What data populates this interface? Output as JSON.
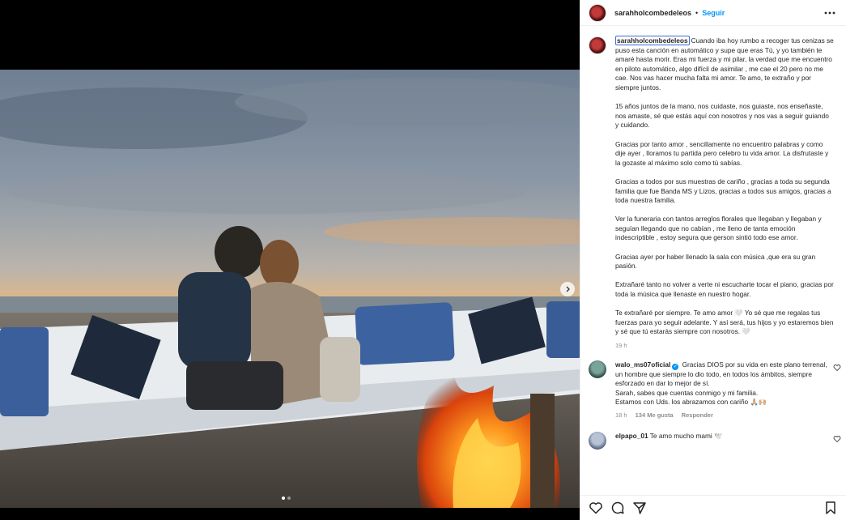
{
  "post": {
    "username": "sarahholcombedeleos",
    "follow_label": "Seguir",
    "separator": "•",
    "caption": [
      "Cuando iba hoy rumbo a recoger tus cenizas se puso esta canción en automático y supe que eras Tú, y yo también te amaré hasta morir. Eras mi fuerza y mi pilar, la verdad que me encuentro en piloto automático, algo difícil de asimilar , me cae el 20 pero no me cae. Nos vas hacer mucha falta mi amor. Te amo, te extraño y por siempre juntos.",
      "15 años juntos de la mano, nos cuidaste, nos guiaste, nos enseñaste, nos amaste, sé que estás aquí con nosotros y nos vas a seguir guiando y cuidando.",
      "Gracias por tanto amor , sencillamente no encuentro palabras y como dije ayer , lloramos tu partida pero celebro tu vida amor. La disfrutaste y la gozaste al máximo solo como tú sabías.",
      "Gracias a todos por sus muestras de cariño , gracias a toda su segunda familia que fue Banda MS y Lizos, gracias a todos sus amigos, gracias a toda nuestra familia.",
      "Ver la funeraria con tantos arreglos florales que llegaban y llegaban y seguían llegando que no cabían , me lleno de tanta emoción indescriptible , estoy segura que gerson sintió todo ese amor.",
      "Gracias ayer por haber llenado la sala con música ,que era su gran pasión.",
      "Extrañaré tanto no volver a verte ni escucharte tocar el piano, gracias por toda la música que llenaste en nuestro hogar.",
      "Te extrañaré por siempre. Te amo amor 🤍 Yo sé que me regalas tus fuerzas para yo seguir adelante. Y así será, tus hijos y yo estaremos bien y sé que tú estarás siempre con nosotros. 🤍"
    ],
    "time": "19 h",
    "slides": {
      "count": 2,
      "active": 0
    }
  },
  "comments": [
    {
      "user": "walo_ms07oficial",
      "verified": true,
      "text": "Gracias DIOS por su vida en este plano terrenal, un hombre que siempre lo dio todo, en todos los ámbitos, siempre esforzado en dar lo mejor de sí.",
      "text2": "Sarah, sabes que cuentas conmigo y mi familia.",
      "text3": "Estamos con Uds. los abrazamos con cariño 🙏🏼🙌🏼",
      "time": "18 h",
      "likes": "134 Me gusta",
      "reply": "Responder"
    },
    {
      "user": "elpapo_01",
      "verified": false,
      "text": "Te amo mucho mami 🕊️"
    }
  ],
  "icons": [
    "more-icon",
    "arrow-right-icon",
    "heart-icon",
    "comment-icon",
    "share-icon",
    "bookmark-icon"
  ]
}
